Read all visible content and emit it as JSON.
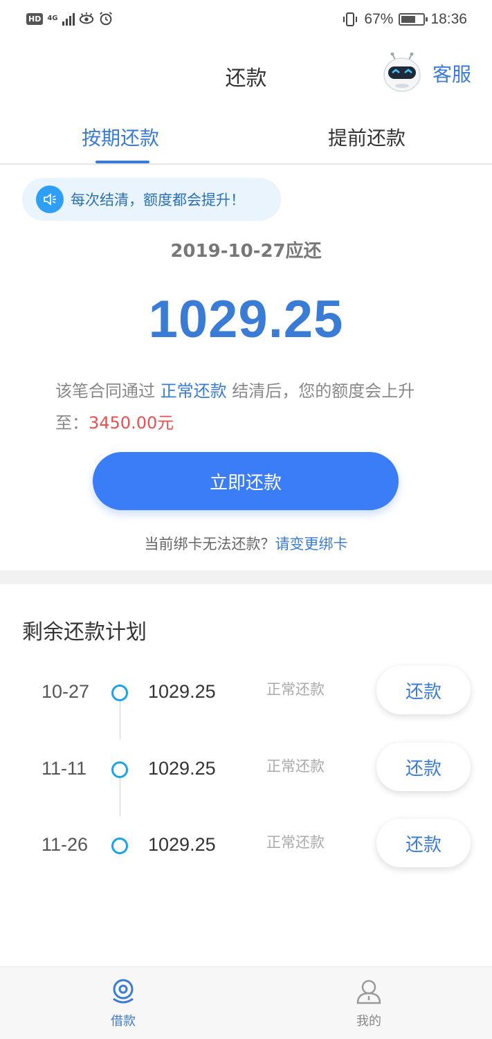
{
  "status_bar": {
    "hd": "HD",
    "network": "4G",
    "battery": "67%",
    "battery_level": 0.67,
    "time": "18:36"
  },
  "header": {
    "title": "还款",
    "service_label": "客服"
  },
  "tabs": [
    {
      "label": "按期还款",
      "active": true
    },
    {
      "label": "提前还款",
      "active": false
    }
  ],
  "notice": {
    "text": "每次结清，额度都会提升！"
  },
  "due": {
    "date_label": "2019-10-27应还",
    "amount": "1029.25"
  },
  "description": {
    "part1": "该笔合同通过 ",
    "highlight": "正常还款",
    "part2": " 结清后，您的额度会上升至：",
    "limit": "3450.00元"
  },
  "repay_button": {
    "label": "立即还款"
  },
  "card_tip": {
    "text": "当前绑卡无法还款？",
    "link": "请变更绑卡"
  },
  "plan": {
    "title": "剩余还款计划",
    "rows": [
      {
        "date": "10-27",
        "amount": "1029.25",
        "status": "正常还款",
        "button": "还款"
      },
      {
        "date": "11-11",
        "amount": "1029.25",
        "status": "正常还款",
        "button": "还款"
      },
      {
        "date": "11-26",
        "amount": "1029.25",
        "status": "正常还款",
        "button": "还款"
      }
    ]
  },
  "bottom_nav": [
    {
      "label": "借款",
      "icon": "borrow-icon",
      "active": true
    },
    {
      "label": "我的",
      "icon": "user-icon",
      "active": false
    }
  ],
  "colors": {
    "accent": "#3a7bd5",
    "button": "#3b7cf7",
    "highlight_red": "#e85050",
    "timeline_dot": "#1aa3e6"
  }
}
